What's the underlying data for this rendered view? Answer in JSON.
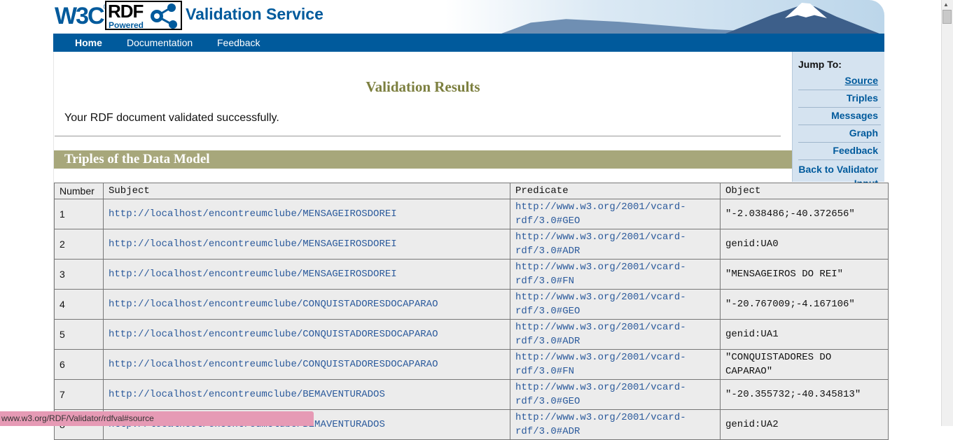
{
  "header": {
    "w3c_logo": "W3C",
    "rdf_logo": "RDF",
    "rdf_powered": "Powered",
    "title": "Validation Service"
  },
  "nav": {
    "items": [
      {
        "label": "Home"
      },
      {
        "label": "Documentation"
      },
      {
        "label": "Feedback"
      }
    ]
  },
  "main": {
    "results_title": "Validation Results",
    "result_message": "Your RDF document validated successfully.",
    "section_title": "Triples of the Data Model"
  },
  "jump": {
    "title": "Jump To:",
    "links": [
      {
        "label": "Source"
      },
      {
        "label": "Triples"
      },
      {
        "label": "Messages"
      },
      {
        "label": "Graph"
      },
      {
        "label": "Feedback"
      },
      {
        "label": "Back to Validator Input"
      }
    ]
  },
  "table": {
    "headers": [
      "Number",
      "Subject",
      "Predicate",
      "Object"
    ],
    "rows": [
      {
        "number": "1",
        "subject": "http://localhost/encontreumclube/MENSAGEIROSDOREI",
        "predicate": "http://www.w3.org/2001/vcard-rdf/3.0#GEO",
        "object": "\"-2.038486;-40.372656\""
      },
      {
        "number": "2",
        "subject": "http://localhost/encontreumclube/MENSAGEIROSDOREI",
        "predicate": "http://www.w3.org/2001/vcard-rdf/3.0#ADR",
        "object": "genid:UA0"
      },
      {
        "number": "3",
        "subject": "http://localhost/encontreumclube/MENSAGEIROSDOREI",
        "predicate": "http://www.w3.org/2001/vcard-rdf/3.0#FN",
        "object": "\"MENSAGEIROS DO REI\""
      },
      {
        "number": "4",
        "subject": "http://localhost/encontreumclube/CONQUISTADORESDOCAPARAO",
        "predicate": "http://www.w3.org/2001/vcard-rdf/3.0#GEO",
        "object": "\"-20.767009;-4.167106\""
      },
      {
        "number": "5",
        "subject": "http://localhost/encontreumclube/CONQUISTADORESDOCAPARAO",
        "predicate": "http://www.w3.org/2001/vcard-rdf/3.0#ADR",
        "object": "genid:UA1"
      },
      {
        "number": "6",
        "subject": "http://localhost/encontreumclube/CONQUISTADORESDOCAPARAO",
        "predicate": "http://www.w3.org/2001/vcard-rdf/3.0#FN",
        "object": "\"CONQUISTADORES DO CAPARAO\""
      },
      {
        "number": "7",
        "subject": "http://localhost/encontreumclube/BEMAVENTURADOS",
        "predicate": "http://www.w3.org/2001/vcard-rdf/3.0#GEO",
        "object": "\"-20.355732;-40.345813\""
      },
      {
        "number": "8",
        "subject": "http://localhost/encontreumclube/BEMAVENTURADOS",
        "predicate": "http://www.w3.org/2001/vcard-rdf/3.0#ADR",
        "object": "genid:UA2"
      }
    ]
  },
  "statusbar": {
    "url": "www.w3.org/RDF/Validator/rdfval#source"
  },
  "colors": {
    "brand": "#005a9c",
    "section_bar": "#a7a77b",
    "title_olive": "#7c7f3f",
    "jump_bg": "#d5e3f0",
    "status_bg": "#e69ab5"
  }
}
